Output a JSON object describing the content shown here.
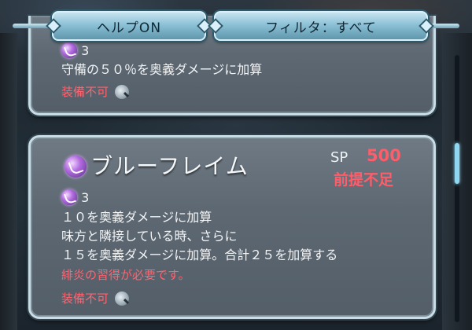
{
  "header": {
    "help_label": "ヘルプON",
    "filter_label": "フィルタ：すべて"
  },
  "skills": [
    {
      "cooldown": "3",
      "lines": [
        "守備の５０％を奥義ダメージに加算"
      ],
      "equip_status": "装備不可"
    },
    {
      "name": "ブルーフレイム",
      "sp_label": "SP",
      "sp_cost": "500",
      "prereq_status": "前提不足",
      "cooldown": "3",
      "lines": [
        "１０を奥義ダメージに加算",
        "味方と隣接している時、さらに",
        "１５を奥義ダメージに加算。合計２５を加算する"
      ],
      "requirement": "緋炎の習得が必要です。",
      "equip_status": "装備不可"
    }
  ],
  "icons": {
    "special": "special-skill-icon",
    "magnifier": "magnifier-icon"
  },
  "colors": {
    "warning_red": "#ff6470",
    "accent_cyan": "#8fd6f0"
  }
}
